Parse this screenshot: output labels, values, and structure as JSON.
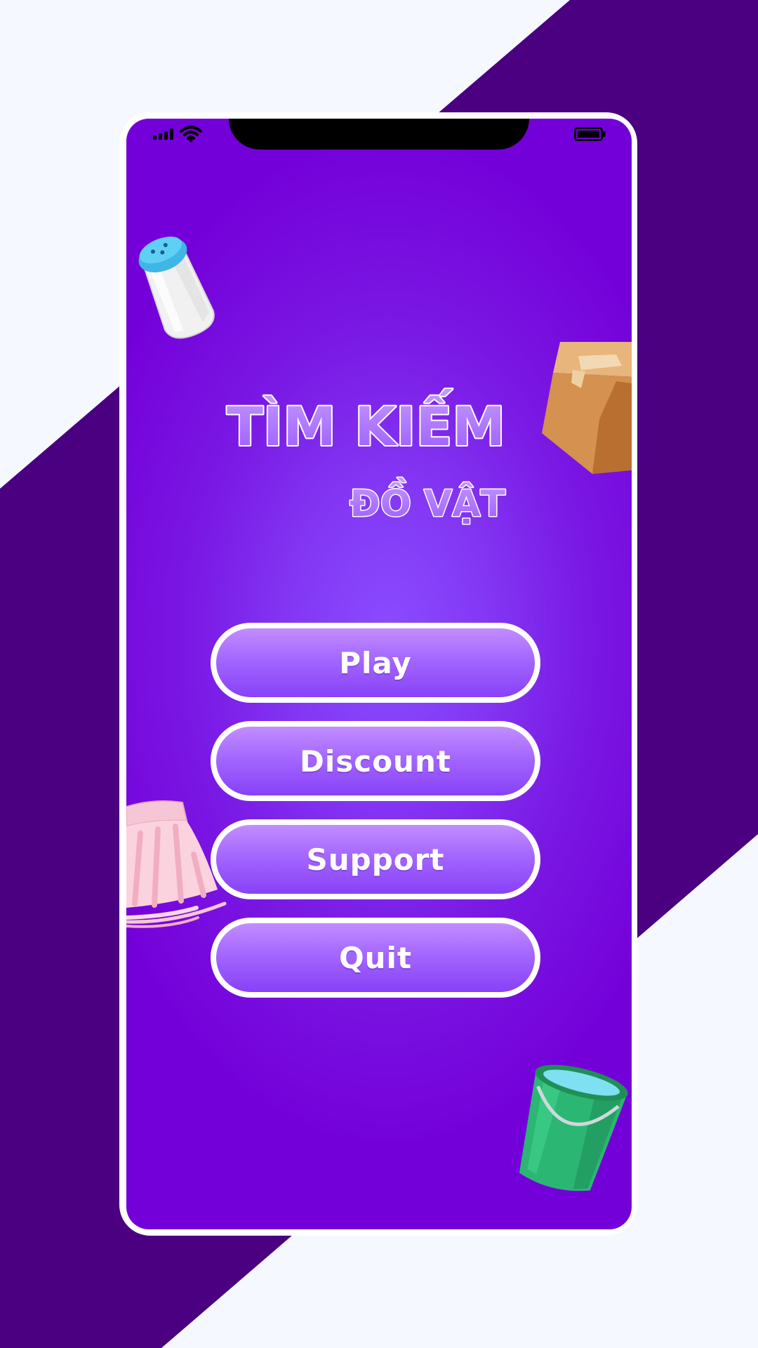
{
  "app": {
    "title_line1": "TÌM KIẾM",
    "title_line2": "ĐỒ VẬT"
  },
  "status_bar": {
    "signal_icon": "cellular-signal-icon",
    "wifi_icon": "wifi-icon",
    "battery_icon": "battery-full-icon"
  },
  "menu": {
    "items": [
      {
        "label": "Play"
      },
      {
        "label": "Discount"
      },
      {
        "label": "Support"
      },
      {
        "label": "Quit"
      }
    ]
  },
  "decorations": [
    "salt-shaker-icon",
    "cardboard-box-icon",
    "pink-skirt-icon",
    "green-bucket-icon"
  ],
  "colors": {
    "background_light": "#f5f9ff",
    "background_band": "#4a0080",
    "screen_purple": "#7a00dd",
    "button_top": "#c28dff",
    "button_bottom": "#8741f7",
    "button_border": "#ffffff"
  }
}
